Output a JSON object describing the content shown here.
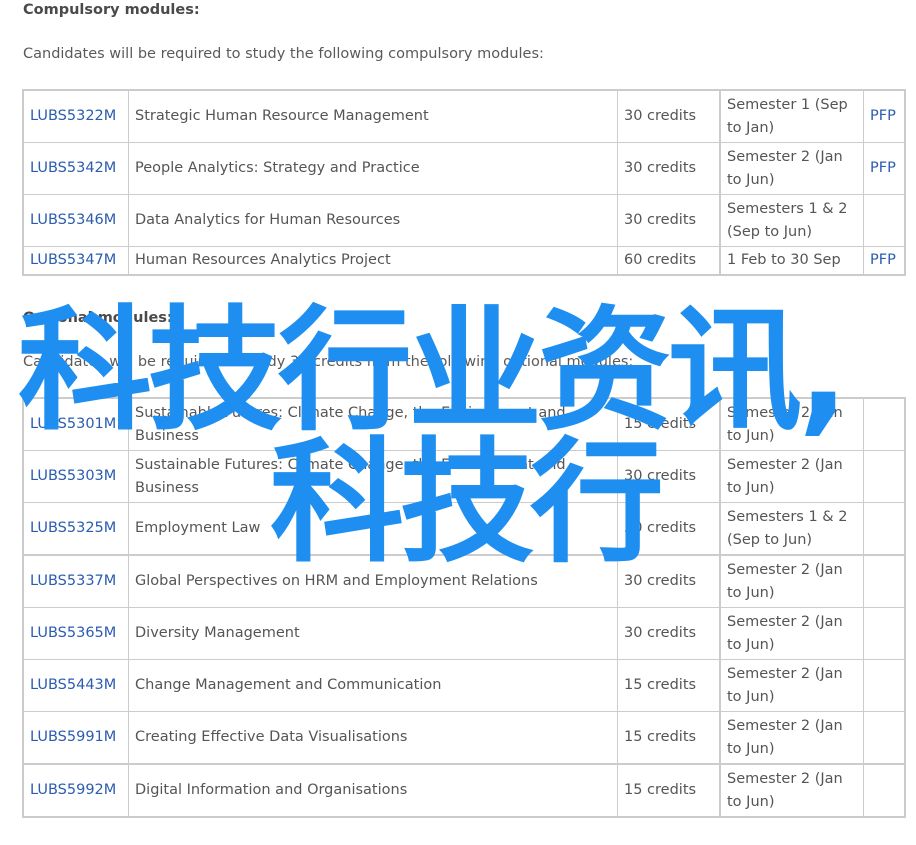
{
  "compulsory": {
    "heading": "Compulsory modules:",
    "intro": "Candidates will be required to study the following compulsory modules:",
    "rows": [
      {
        "code": "LUBS5322M",
        "title": "Strategic Human Resource Management",
        "credits": "30 credits",
        "semester": "Semester 1 (Sep to Jan)",
        "pfp": "PFP"
      },
      {
        "code": "LUBS5342M",
        "title": "People Analytics: Strategy and Practice",
        "credits": "30 credits",
        "semester": "Semester 2 (Jan to Jun)",
        "pfp": "PFP"
      },
      {
        "code": "LUBS5346M",
        "title": "Data Analytics for Human Resources",
        "credits": "30 credits",
        "semester": "Semesters 1 & 2 (Sep to Jun)",
        "pfp": ""
      },
      {
        "code": "LUBS5347M",
        "title": "Human Resources Analytics Project",
        "credits": "60 credits",
        "semester": "1 Feb to 30 Sep",
        "pfp": "PFP"
      }
    ]
  },
  "optional": {
    "heading": "Optional modules:",
    "intro": "Candidates will be required to study 30 credits from the following optional modules:",
    "rows": [
      {
        "code": "LUBS5301M",
        "title": "Sustainable Futures: Climate Change, the Environment and Business",
        "credits": "15 credits",
        "semester": "Semester 2 (Jan to Jun)",
        "pfp": ""
      },
      {
        "code": "LUBS5303M",
        "title": "Sustainable Futures: Climate Change, the Environment and Business",
        "credits": "30 credits",
        "semester": "Semester 2 (Jan to Jun)",
        "pfp": ""
      },
      {
        "code": "LUBS5325M",
        "title": "Employment Law",
        "credits": "30 credits",
        "semester": "Semesters 1 & 2 (Sep to Jun)",
        "pfp": ""
      },
      {
        "code": "LUBS5337M",
        "title": "Global Perspectives on HRM and Employment Relations",
        "credits": "30 credits",
        "semester": "Semester 2 (Jan to Jun)",
        "pfp": ""
      },
      {
        "code": "LUBS5365M",
        "title": "Diversity Management",
        "credits": "30 credits",
        "semester": "Semester 2 (Jan to Jun)",
        "pfp": ""
      },
      {
        "code": "LUBS5443M",
        "title": "Change Management and Communication",
        "credits": "15 credits",
        "semester": "Semester 2 (Jan to Jun)",
        "pfp": ""
      },
      {
        "code": "LUBS5991M",
        "title": "Creating Effective Data Visualisations",
        "credits": "15 credits",
        "semester": "Semester 2 (Jan to Jun)",
        "pfp": ""
      },
      {
        "code": "LUBS5992M",
        "title": "Digital Information and Organisations",
        "credits": "15 credits",
        "semester": "Semester 2 (Jan to Jun)",
        "pfp": ""
      }
    ]
  },
  "watermark": {
    "line1": "科技行业资讯,",
    "line2": "科技行",
    "color": "#1e8ff0"
  },
  "colors": {
    "link": "#2b5cb0",
    "text": "#555555",
    "border": "#cccccc"
  }
}
